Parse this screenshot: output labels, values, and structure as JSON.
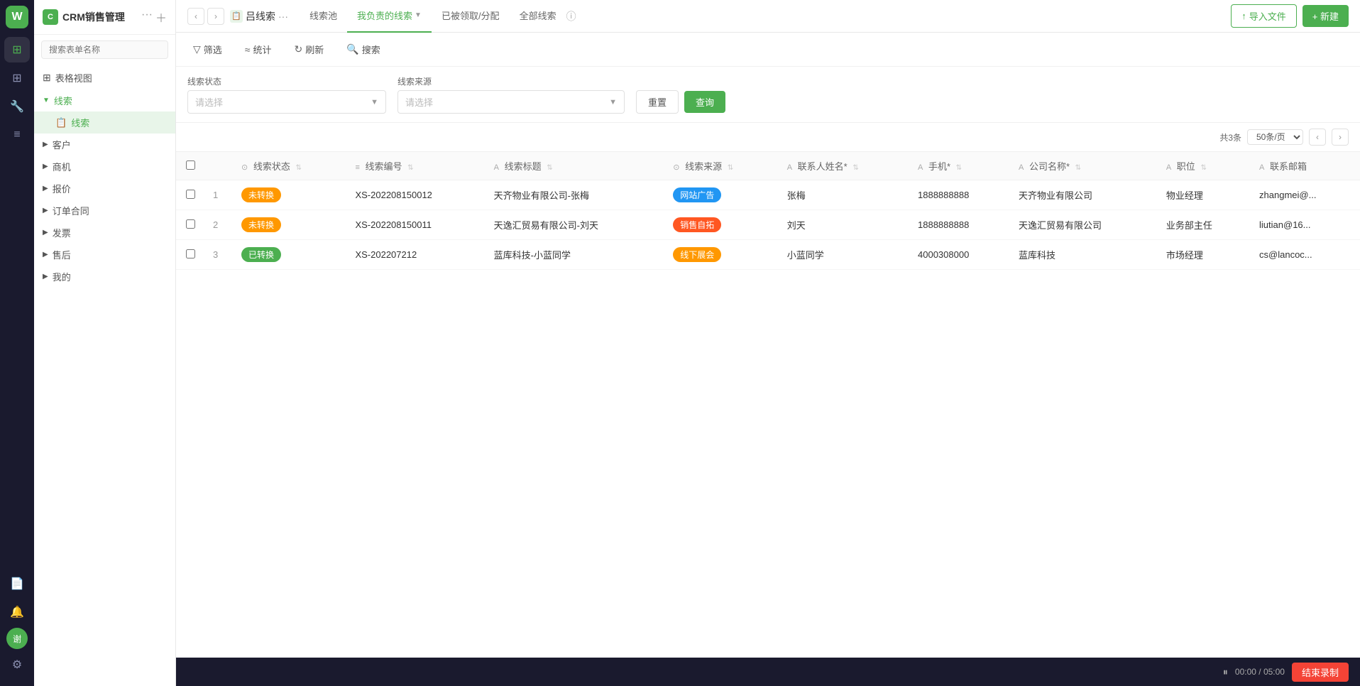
{
  "app": {
    "title": "CRM销售管理",
    "logo_text": "C"
  },
  "sidebar": {
    "search_placeholder": "搜索表单名称",
    "table_view_label": "表格视图",
    "groups": [
      {
        "label": "线索",
        "icon": "📋",
        "open": true,
        "sub_items": [
          {
            "label": "线索",
            "active": true
          }
        ]
      },
      {
        "label": "客户",
        "icon": "👤",
        "open": false
      },
      {
        "label": "商机",
        "icon": "💼",
        "open": false
      },
      {
        "label": "报价",
        "icon": "📄",
        "open": false
      },
      {
        "label": "订单合同",
        "icon": "📑",
        "open": false
      },
      {
        "label": "发票",
        "icon": "🧾",
        "open": false
      },
      {
        "label": "售后",
        "icon": "🔧",
        "open": false
      },
      {
        "label": "我的",
        "icon": "👤",
        "open": false
      }
    ]
  },
  "topbar": {
    "breadcrumb": "吕线索",
    "breadcrumb_icon": "📋",
    "tabs": [
      {
        "label": "线索池",
        "active": false
      },
      {
        "label": "我负责的线索",
        "active": true,
        "has_arrow": true
      },
      {
        "label": "已被领取/分配",
        "active": false
      },
      {
        "label": "全部线索",
        "active": false
      }
    ],
    "import_btn": "导入文件",
    "new_btn": "+ 新建"
  },
  "toolbar": {
    "filter_label": "筛选",
    "stats_label": "统计",
    "refresh_label": "刷新",
    "search_label": "搜索"
  },
  "filter": {
    "status_label": "线索状态",
    "source_label": "线索来源",
    "status_placeholder": "请选择",
    "source_placeholder": "请选择",
    "reset_btn": "重置",
    "query_btn": "查询"
  },
  "table": {
    "total_text": "共3条",
    "per_page": "50条/页",
    "columns": [
      {
        "label": "线索状态",
        "type": "status"
      },
      {
        "label": "线索编号",
        "type": "serial"
      },
      {
        "label": "线索标题",
        "type": "text"
      },
      {
        "label": "线索来源",
        "type": "source"
      },
      {
        "label": "联系人姓名*",
        "type": "text"
      },
      {
        "label": "手机*",
        "type": "text"
      },
      {
        "label": "公司名称*",
        "type": "text"
      },
      {
        "label": "职位",
        "type": "text"
      },
      {
        "label": "联系邮箱",
        "type": "text"
      }
    ],
    "rows": [
      {
        "num": "1",
        "status": "未转换",
        "status_type": "unconverted",
        "serial": "XS-202208150012",
        "title": "天齐物业有限公司-张梅",
        "source": "网站广告",
        "source_type": "web",
        "contact": "张梅",
        "phone": "1888888888",
        "company": "天齐物业有限公司",
        "position": "物业经理",
        "email": "zhangmei@..."
      },
      {
        "num": "2",
        "status": "未转换",
        "status_type": "unconverted",
        "serial": "XS-202208150011",
        "title": "天逸汇贸易有限公司-刘天",
        "source": "销售自拓",
        "source_type": "sales",
        "contact": "刘天",
        "phone": "1888888888",
        "company": "天逸汇贸易有限公司",
        "position": "业务部主任",
        "email": "liutian@16..."
      },
      {
        "num": "3",
        "status": "已转换",
        "status_type": "converted",
        "serial": "XS-202207212",
        "title": "蓝库科技-小蓝同学",
        "source": "线下展会",
        "source_type": "offline",
        "contact": "小蓝同学",
        "phone": "4000308000",
        "company": "蓝库科技",
        "position": "市场经理",
        "email": "cs@lancoc..."
      }
    ]
  },
  "bottom": {
    "timer": "00:00 / 05:00",
    "end_btn": "结束录制"
  }
}
